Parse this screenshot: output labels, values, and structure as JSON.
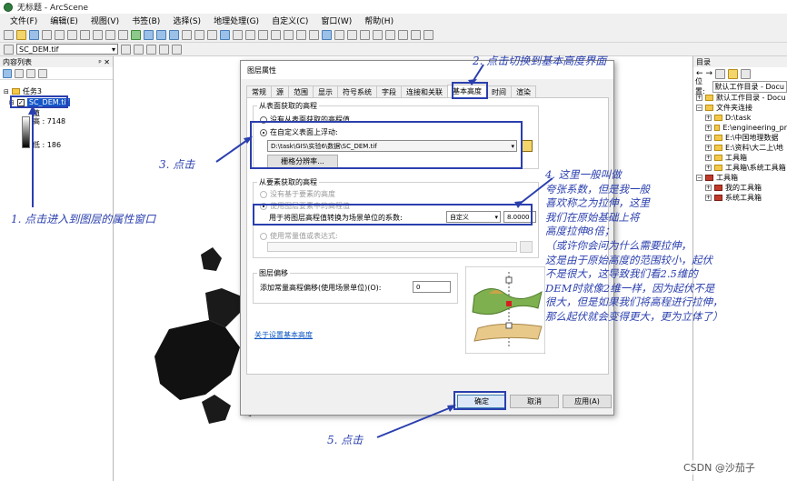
{
  "window": {
    "title": "无标题 - ArcScene"
  },
  "menu": [
    "文件(F)",
    "编辑(E)",
    "视图(V)",
    "书签(B)",
    "选择(S)",
    "地理处理(G)",
    "自定义(C)",
    "窗口(W)",
    "帮助(H)"
  ],
  "layer_selector": {
    "value": "SC_DEM.tif"
  },
  "toc": {
    "title": "内容列表",
    "pin": "ᵖ ✕",
    "scene_name": "任务3",
    "layer_name": "SC_DEM.tif",
    "legend_value_label": "值",
    "legend_high": "高 : 7148",
    "legend_low": "低 : 186"
  },
  "catalog": {
    "title": "目录",
    "location_label": "位置:",
    "location_value": "默认工作目录 - Docu",
    "items": [
      "默认工作目录 - Docu",
      "文件夹连接",
      "D:\\task",
      "E:\\engineering_pr",
      "E:\\中国地理数据",
      "E:\\资料\\大二上\\地",
      "工具箱",
      "工具箱\\系统工具箱",
      "工具箱",
      "我的工具箱",
      "系统工具箱"
    ]
  },
  "dialog": {
    "title": "图层属性",
    "tabs": [
      "常规",
      "源",
      "范围",
      "显示",
      "符号系统",
      "字段",
      "连接和关联",
      "基本高度",
      "时间",
      "渲染"
    ],
    "group_surface": "从表面获取的高程",
    "radio_none": "没有从表面获取的高程值",
    "radio_custom": "在自定义表面上浮动:",
    "surface_path": "D:\\task\\GIS\\实验6\\数据\\SC_DEM.tif",
    "raster_res_button": "栅格分辨率...",
    "group_feature": "从要素获取的高程",
    "radio_feature_none": "没有基于要素的高度",
    "radio_feature_use": "使用图层要素中的高程值",
    "factor_label": "用于将图层高程值转换为场景单位的系数:",
    "factor_unit": "自定义",
    "factor_value": "8.0000",
    "radio_expression": "使用常量值或表达式:",
    "group_offset": "图层偏移",
    "offset_label": "添加常量高程偏移(使用场景单位)(O):",
    "offset_value": "0",
    "about_link": "关于设置基本高度",
    "ok": "确定",
    "cancel": "取消",
    "apply": "应用(A)"
  },
  "annotations": {
    "a1": "1. 点击进入到图层的属性窗口",
    "a2": "2. 点击切换到基本高度界面",
    "a3": "3. 点击",
    "a4_lines": [
      "4. 这里一般叫做",
      "夸张系数，但是我一般",
      "喜欢称之为拉伸，这里",
      "我们在原始基础上将",
      "高度拉伸8倍；",
      "（或许你会问为什么需要拉伸，",
      "这是由于原始高度的范围较小，起伏",
      "不是很大，这导致我们看2.5维的",
      "DEM时就像2维一样，因为起伏不是",
      "很大，但是如果我们将高程进行拉伸，",
      "那么起伏就会变得更大，更为立体了）"
    ],
    "a5": "5. 点击"
  },
  "watermark": "CSDN @沙茄子"
}
